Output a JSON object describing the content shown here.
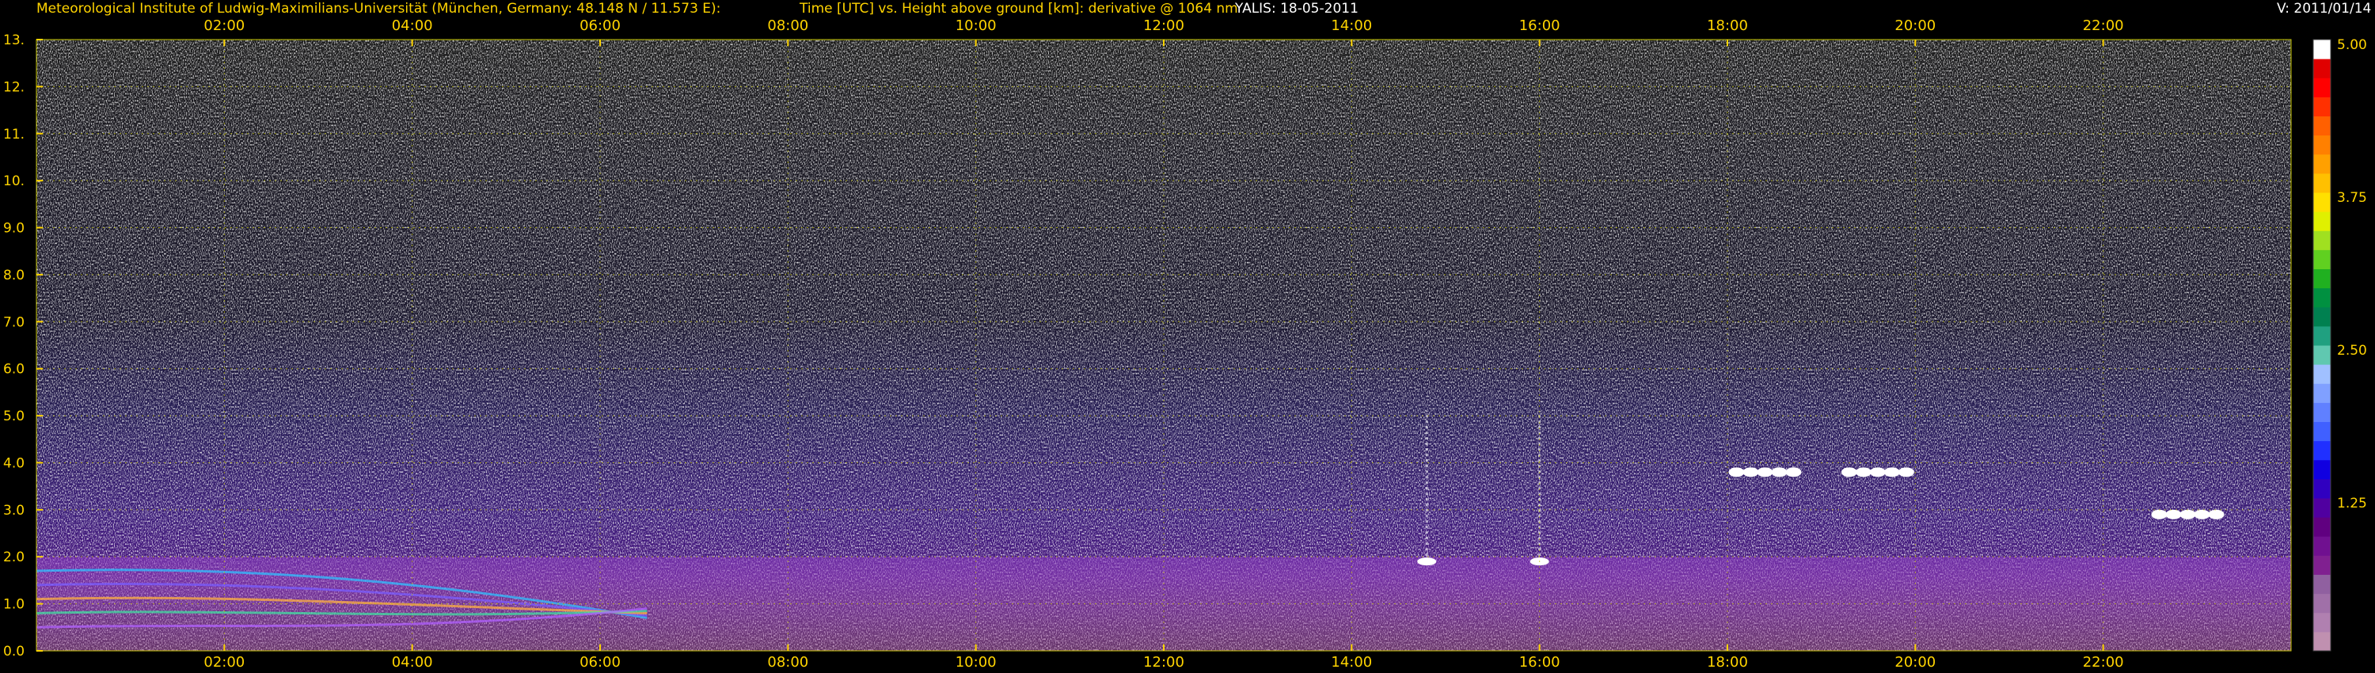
{
  "header": {
    "institute": "Meteorological Institute of Ludwig-Maximilians-Universität (München, Germany: 48.148 N / 11.573 E):",
    "title": "Time [UTC] vs. Height above ground [km]: derivative @ 1064 nm",
    "instrument_date": "YALIS: 18-05-2011",
    "version": "V: 2011/01/14"
  },
  "chart_data": {
    "type": "heatmap",
    "title": "Time [UTC] vs. Height above ground [km]: derivative @ 1064 nm",
    "xlabel": "Time [UTC]",
    "ylabel": "Height above ground [km]",
    "xlim_hours": [
      0,
      24
    ],
    "ylim_km": [
      0,
      13
    ],
    "grid": true,
    "x_ticks": [
      "02:00",
      "04:00",
      "06:00",
      "08:00",
      "10:00",
      "12:00",
      "14:00",
      "16:00",
      "18:00",
      "20:00",
      "22:00"
    ],
    "x_tick_hours": [
      2,
      4,
      6,
      8,
      10,
      12,
      14,
      16,
      18,
      20,
      22
    ],
    "y_ticks": [
      "0.0",
      "1.0",
      "2.0",
      "3.0",
      "4.0",
      "5.0",
      "6.0",
      "7.0",
      "8.0",
      "9.0",
      "10.",
      "11.",
      "12.",
      "13."
    ],
    "y_tick_values": [
      0,
      1,
      2,
      3,
      4,
      5,
      6,
      7,
      8,
      9,
      10,
      11,
      12,
      13
    ],
    "colorbar": {
      "range": [
        0,
        5
      ],
      "tick_labels": [
        "1.25",
        "2.50",
        "3.75",
        "5.00"
      ],
      "tick_values": [
        1.25,
        2.5,
        3.75,
        5.0
      ],
      "colors": [
        "#c090b0",
        "#b080b0",
        "#a070a8",
        "#9060a0",
        "#802090",
        "#701090",
        "#600080",
        "#5000a0",
        "#3000c0",
        "#1000e0",
        "#2030ff",
        "#4060ff",
        "#6080ff",
        "#80a0ff",
        "#a0c0ff",
        "#60c8b0",
        "#20a080",
        "#008050",
        "#009040",
        "#20b020",
        "#60d020",
        "#a0e020",
        "#e0f000",
        "#ffe000",
        "#ffc000",
        "#ffa000",
        "#ff8000",
        "#ff6000",
        "#ff3000",
        "#ff0000",
        "#e00000",
        "#ffffff"
      ]
    },
    "features": [
      {
        "name": "boundary layer",
        "x_start": 0,
        "x_end": 24,
        "y_top": 2.0
      },
      {
        "name": "cloud",
        "x": 18.4,
        "y": 3.8
      },
      {
        "name": "cloud",
        "x": 19.6,
        "y": 3.8
      },
      {
        "name": "cloud",
        "x": 22.9,
        "y": 2.9
      },
      {
        "name": "convective plume",
        "x": 14.8,
        "y": 1.9
      },
      {
        "name": "convective plume",
        "x": 16.0,
        "y": 1.9
      }
    ]
  }
}
